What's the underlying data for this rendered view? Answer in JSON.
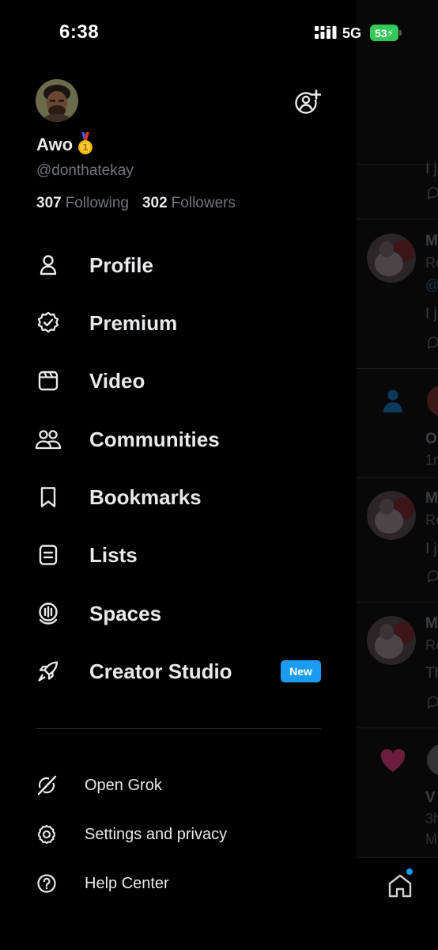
{
  "status_bar": {
    "time": "6:38",
    "network": "5G",
    "battery": "53",
    "battery_color": "#34c759"
  },
  "account": {
    "display_name": "Awo",
    "handle": "@donthatekay",
    "following_count": "307",
    "following_label": "Following",
    "followers_count": "302",
    "followers_label": "Followers",
    "add_account_icon": "add-account-icon",
    "badge_icon": "gold-medal-icon"
  },
  "menu": {
    "items": [
      {
        "label": "Profile",
        "icon": "person-icon"
      },
      {
        "label": "Premium",
        "icon": "verified-badge-icon"
      },
      {
        "label": "Video",
        "icon": "video-icon"
      },
      {
        "label": "Communities",
        "icon": "communities-icon"
      },
      {
        "label": "Bookmarks",
        "icon": "bookmark-icon"
      },
      {
        "label": "Lists",
        "icon": "list-icon"
      },
      {
        "label": "Spaces",
        "icon": "spaces-icon"
      },
      {
        "label": "Creator Studio",
        "icon": "rocket-icon"
      }
    ],
    "new_badge": "New"
  },
  "secondary_menu": {
    "items": [
      {
        "label": "Open Grok",
        "icon": "grok-icon"
      },
      {
        "label": "Settings and privacy",
        "icon": "gear-icon"
      },
      {
        "label": "Help Center",
        "icon": "help-icon"
      }
    ]
  },
  "background": {
    "snippets": [
      "I j",
      "M",
      "Re",
      "@",
      "I ju",
      "O",
      "1n",
      "M",
      "Re",
      "I j",
      "M",
      "Re",
      "Th",
      "V",
      "3h",
      "M"
    ]
  },
  "colors": {
    "accent": "#1d9bf0",
    "text": "#e7e9ea",
    "muted": "#71767b",
    "heart": "#6b1e3c"
  }
}
